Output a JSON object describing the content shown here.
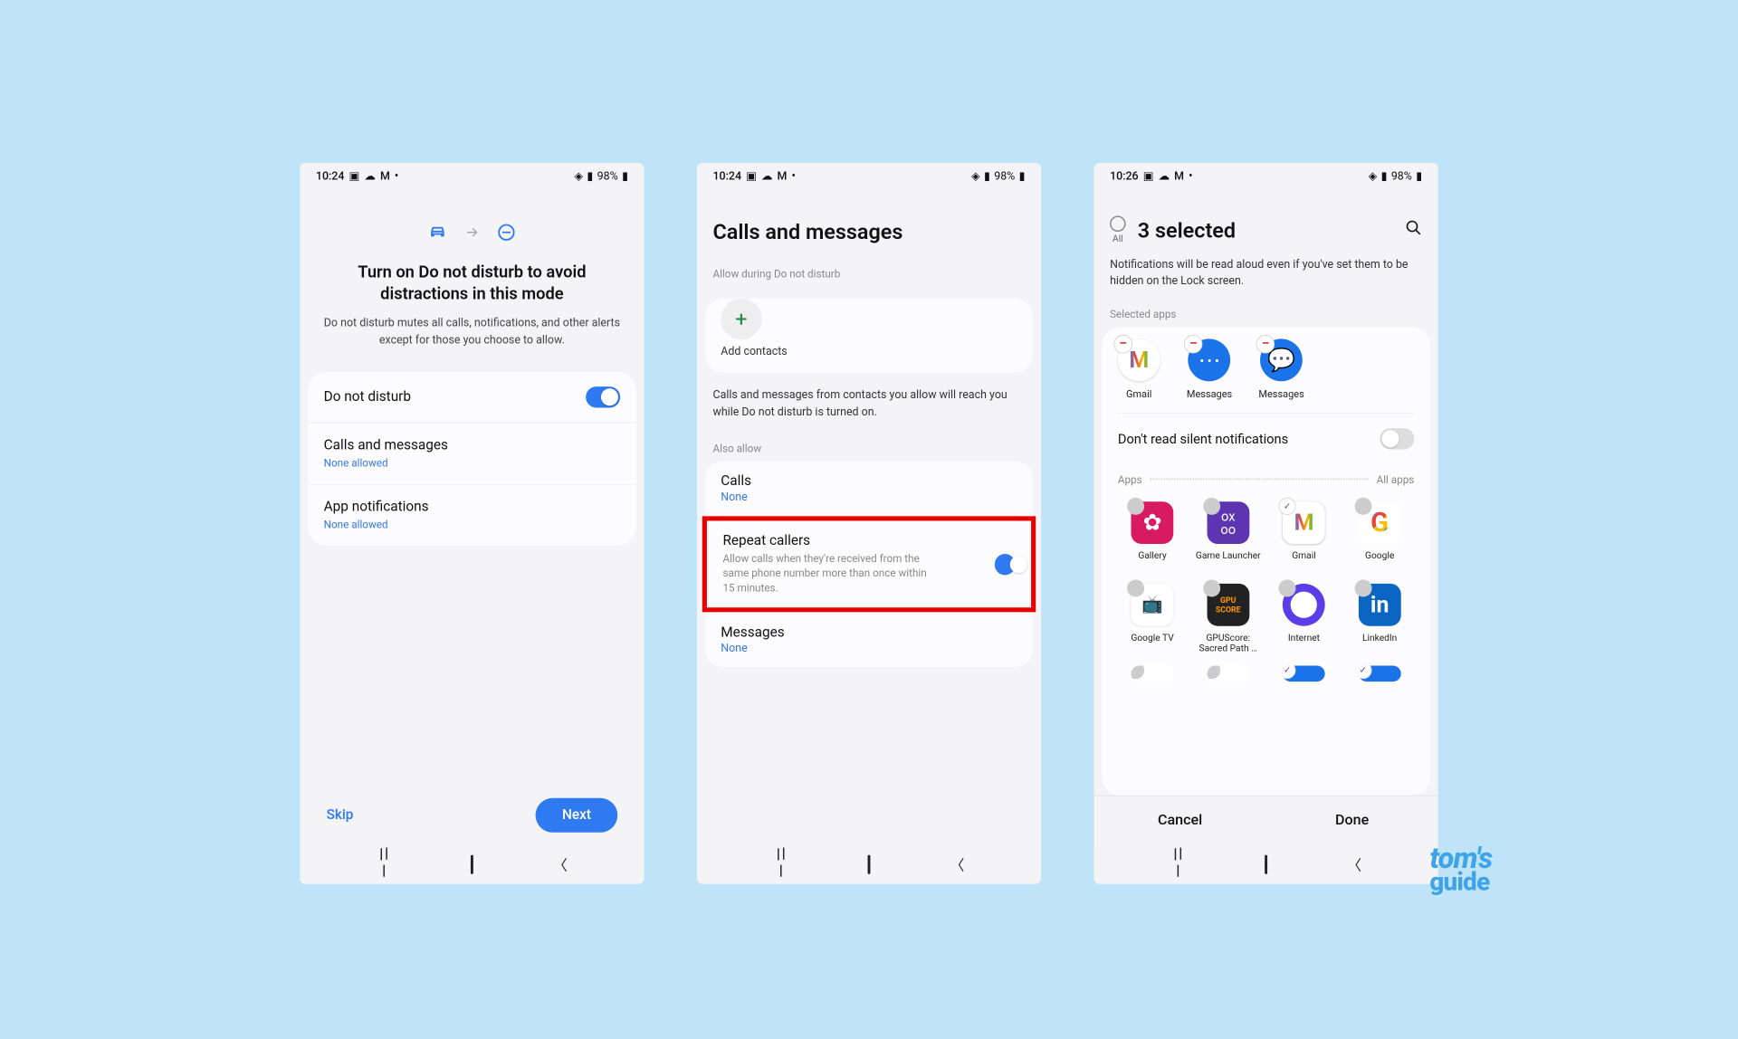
{
  "statusbar": {
    "time1": "10:24",
    "time2": "10:24",
    "time3": "10:26",
    "battery": "98%"
  },
  "screen1": {
    "title": "Turn on Do not disturb to avoid distractions in this mode",
    "subtitle": "Do not disturb mutes all calls, notifications, and other alerts except for those you choose to allow.",
    "dnd": {
      "label": "Do not disturb",
      "on": true
    },
    "calls": {
      "label": "Calls and messages",
      "sub": "None allowed"
    },
    "apps": {
      "label": "App notifications",
      "sub": "None allowed"
    },
    "skip": "Skip",
    "next": "Next"
  },
  "screen2": {
    "title": "Calls and messages",
    "allowDuring": "Allow during Do not disturb",
    "addContacts": "Add contacts",
    "info": "Calls and messages from contacts you allow will reach you while Do not disturb is turned on.",
    "alsoAllow": "Also allow",
    "calls": {
      "label": "Calls",
      "sub": "None"
    },
    "repeat": {
      "label": "Repeat callers",
      "desc": "Allow calls when they're received from the same phone number more than once within 15 minutes.",
      "on": true
    },
    "messages": {
      "label": "Messages",
      "sub": "None"
    }
  },
  "screen3": {
    "allLabel": "All",
    "title": "3 selected",
    "desc": "Notifications will be read aloud even if you've set them to be hidden on the Lock screen.",
    "selectedLabel": "Selected apps",
    "selectedApps": [
      "Gmail",
      "Messages",
      "Messages"
    ],
    "silentLabel": "Don't read silent notifications",
    "silentOn": false,
    "appsLabel": "Apps",
    "allAppsLabel": "All apps",
    "grid": [
      {
        "name": "Gallery",
        "checked": false
      },
      {
        "name": "Game Launcher",
        "checked": false
      },
      {
        "name": "Gmail",
        "checked": true
      },
      {
        "name": "Google",
        "checked": false
      },
      {
        "name": "Google TV",
        "checked": false
      },
      {
        "name": "GPUScore: Sacred Path …",
        "checked": false
      },
      {
        "name": "Internet",
        "checked": false
      },
      {
        "name": "LinkedIn",
        "checked": false
      }
    ],
    "cancel": "Cancel",
    "done": "Done"
  },
  "watermark": {
    "line1": "tom's",
    "line2": "guide"
  }
}
